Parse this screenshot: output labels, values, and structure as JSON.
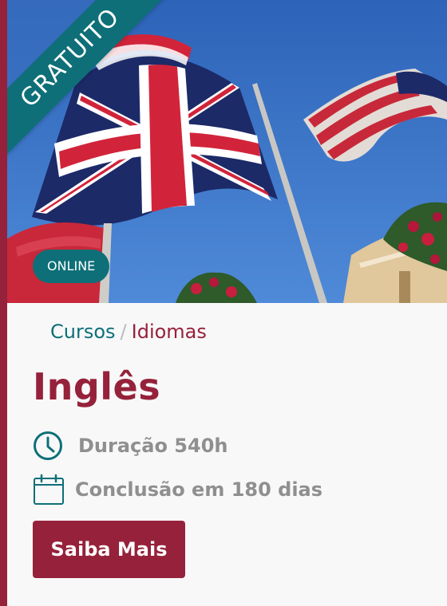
{
  "card": {
    "badge": "GRATUITO",
    "modality": "ONLINE",
    "breadcrumb": {
      "category": "Cursos",
      "separator": "/",
      "subcategory": "Idiomas"
    },
    "title": "Inglês",
    "duration_text": "Duração 540h",
    "completion_text": "Conclusão em 180 dias",
    "cta_label": "Saiba Mais"
  },
  "colors": {
    "brand_red": "#96213a",
    "brand_teal": "#0e6f78",
    "muted_text": "#8f8f8f"
  },
  "icons": {
    "duration": "clock-icon",
    "completion": "calendar-icon"
  }
}
